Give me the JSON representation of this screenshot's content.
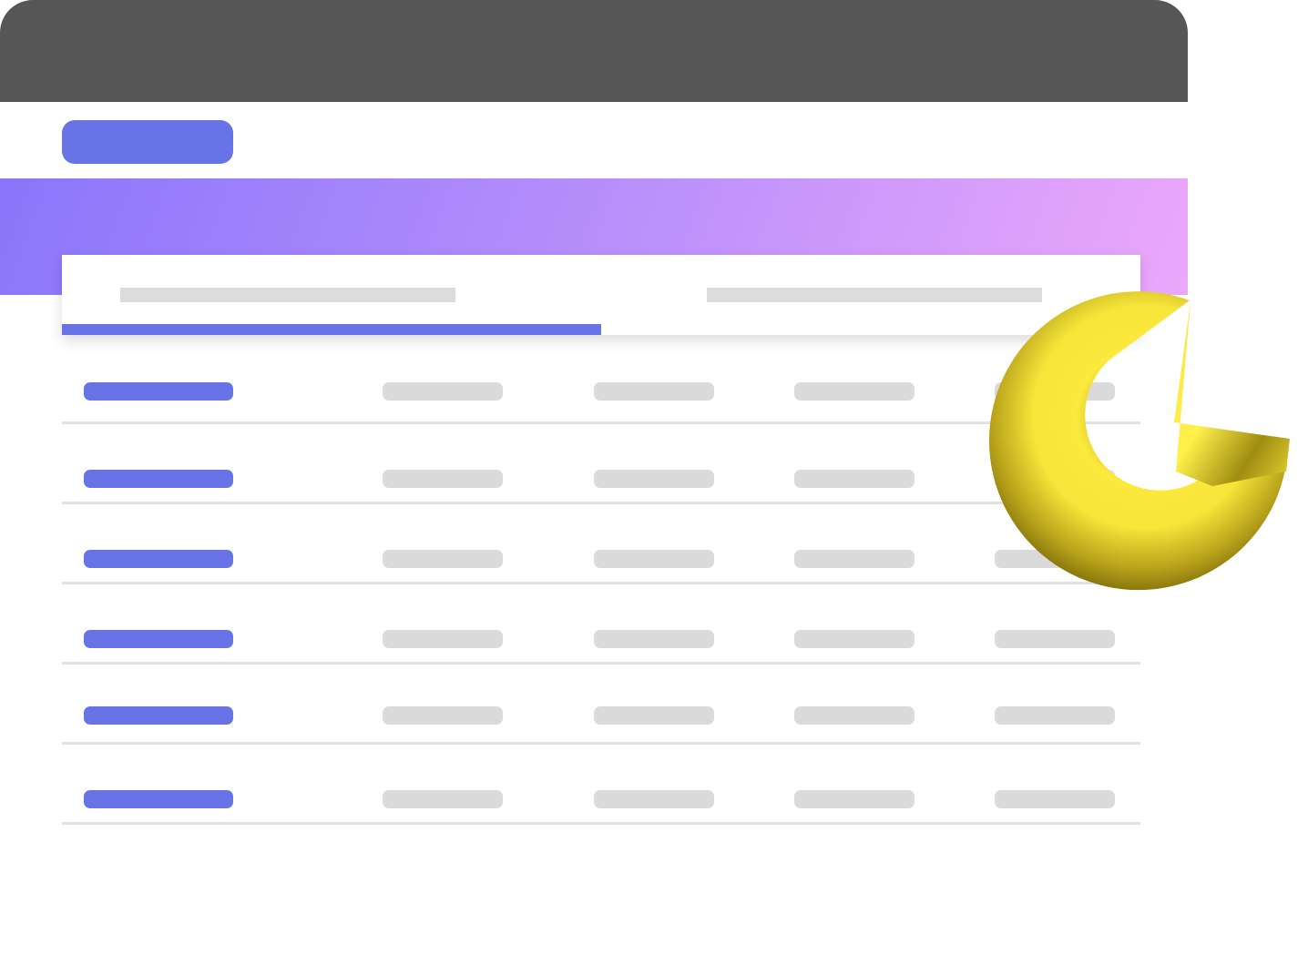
{
  "colors": {
    "titlebar": "#565656",
    "accent": "#6874e6",
    "gradient_start": "#8a76fb",
    "gradient_mid": "#b28cfb",
    "gradient_end": "#eca8fb",
    "placeholder": "#dadada",
    "divider": "#e1e1e1",
    "logo": "#f5e43a"
  },
  "header": {
    "primary_button_icon": "none"
  },
  "tabs": {
    "count": 2,
    "active_index": 0
  },
  "table": {
    "row_count": 6,
    "columns_per_row": 5
  },
  "logo": {
    "icon": "yellow-3d-pie-chart-icon"
  }
}
